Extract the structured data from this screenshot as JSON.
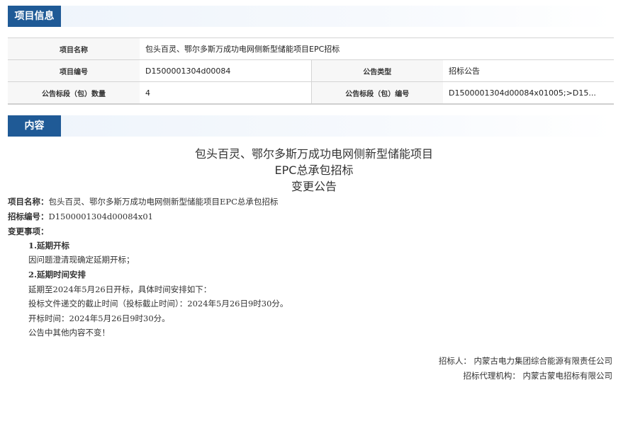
{
  "sections": {
    "info_title": "项目信息",
    "content_title": "内容"
  },
  "info_table": {
    "project_name_label": "项目名称",
    "project_name_value": "包头百灵、鄂尔多斯万成功电网侧新型储能项目EPC招标",
    "project_no_label": "项目编号",
    "project_no_value": "D1500001304d00084",
    "notice_type_label": "公告类型",
    "notice_type_value": "招标公告",
    "lot_count_label": "公告标段（包）数量",
    "lot_count_value": "4",
    "lot_no_label": "公告标段（包）编号",
    "lot_no_value": "D1500001304d00084x01005;>D15..."
  },
  "document": {
    "title_line1": "包头百灵、鄂尔多斯万成功电网侧新型储能项目",
    "title_line2": "EPC总承包招标",
    "title_line3": "变更公告",
    "project_name_label": "项目名称：",
    "project_name": "包头百灵、鄂尔多斯万成功电网侧新型储能项目EPC总承包招标",
    "bid_no_label": "招标编号：",
    "bid_no": "D1500001304d00084x01",
    "change_label": "变更事项：",
    "item1_title": "1.延期开标",
    "item1_text": "因问题澄清现确定延期开标；",
    "item2_title": "2.延期时间安排",
    "item2_line1": "延期至2024年5月26日开标，具体时间安排如下：",
    "item2_line2": "投标文件递交的截止时间（投标截止时间）：2024年5月26日9时30分。",
    "item2_line3": "开标时间：2024年5月26日9时30分。",
    "item2_line4": "公告中其他内容不变！",
    "tenderer": "招标人：  内蒙古电力集团综合能源有限责任公司",
    "agency": "招标代理机构：  内蒙古蒙电招标有限公司"
  }
}
